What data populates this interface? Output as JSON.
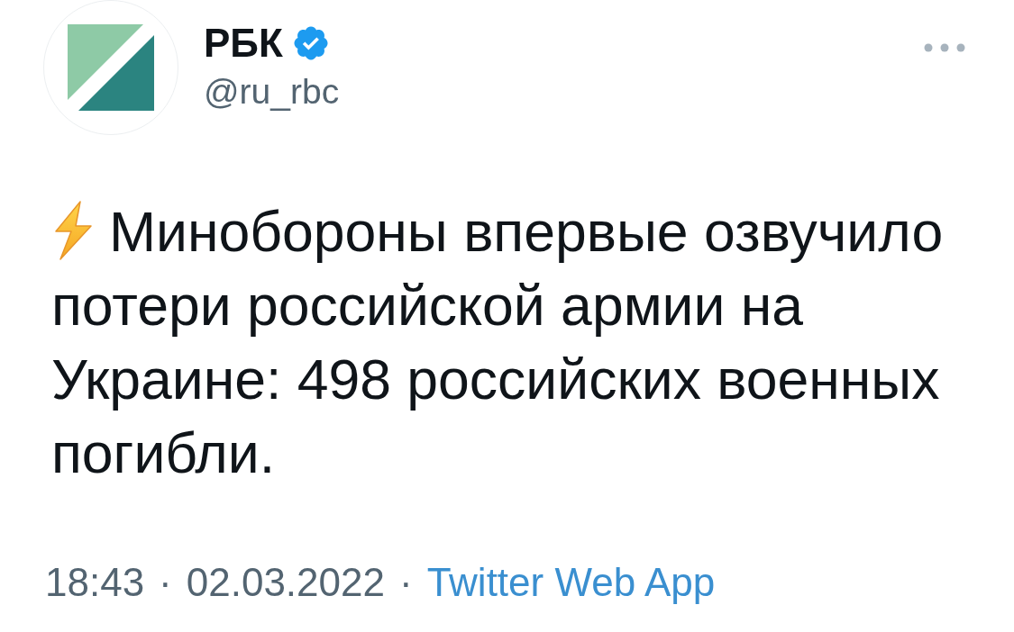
{
  "author": {
    "name": "РБК",
    "verified": true,
    "handle": "@ru_rbc"
  },
  "tweet": {
    "text": "Минобороны впервые озвучило потери российской армии на Украине: 498 российских военных погибли."
  },
  "meta": [
    {
      "kind": "plain",
      "text": "18:43"
    },
    {
      "kind": "plain",
      "text": "·"
    },
    {
      "kind": "plain",
      "text": "02.03.2022"
    },
    {
      "kind": "plain",
      "text": "·"
    },
    {
      "kind": "link",
      "text": "Twitter Web App"
    }
  ]
}
